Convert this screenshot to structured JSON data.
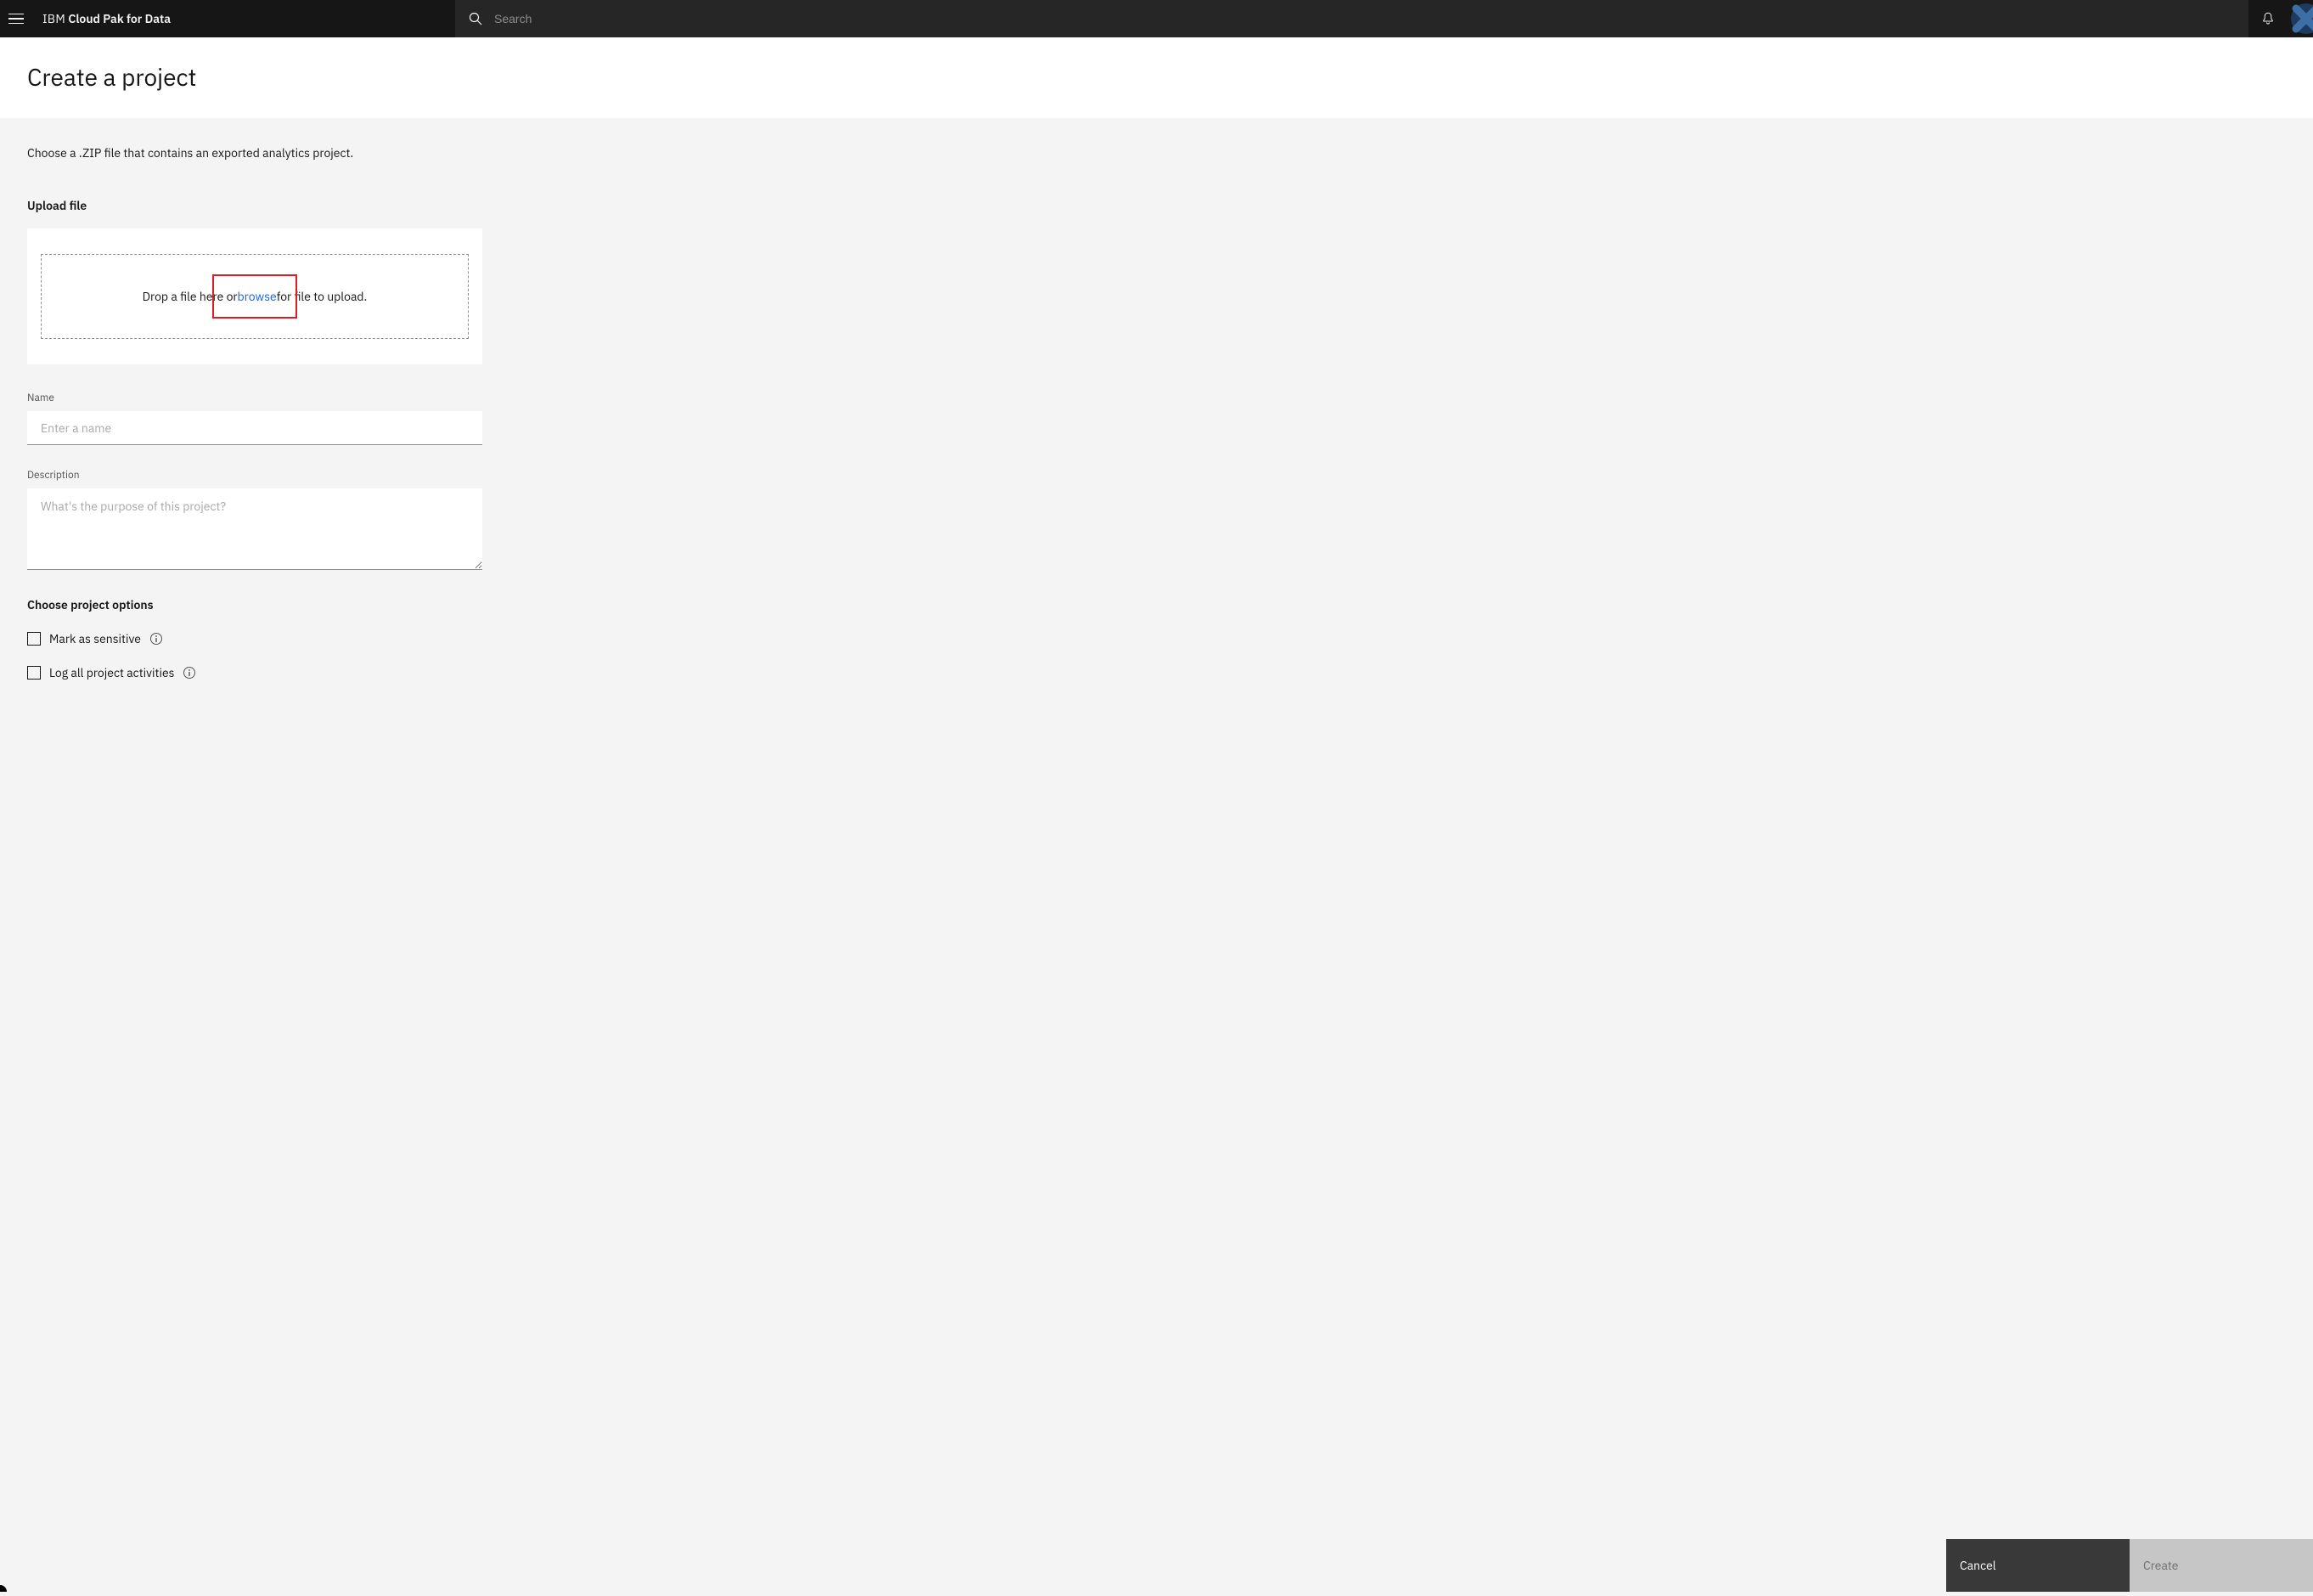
{
  "header": {
    "brand_prefix": "IBM",
    "brand_rest": "Cloud Pak for Data",
    "search_placeholder": "Search"
  },
  "page": {
    "title": "Create a project",
    "instruction": "Choose a .ZIP file that contains an exported analytics project."
  },
  "upload": {
    "section_label": "Upload file",
    "drop_text_before": "Drop a file here or ",
    "browse_label": "browse",
    "drop_text_after": " for file to upload."
  },
  "fields": {
    "name_label": "Name",
    "name_placeholder": "Enter a name",
    "description_label": "Description",
    "description_placeholder": "What's the purpose of this project?"
  },
  "options": {
    "heading": "Choose project options",
    "mark_sensitive": "Mark as sensitive",
    "log_activities": "Log all project activities"
  },
  "footer": {
    "cancel": "Cancel",
    "create": "Create"
  },
  "colors": {
    "header_bg": "#161616",
    "link": "#0f62fe",
    "highlight": "#da1e28"
  }
}
